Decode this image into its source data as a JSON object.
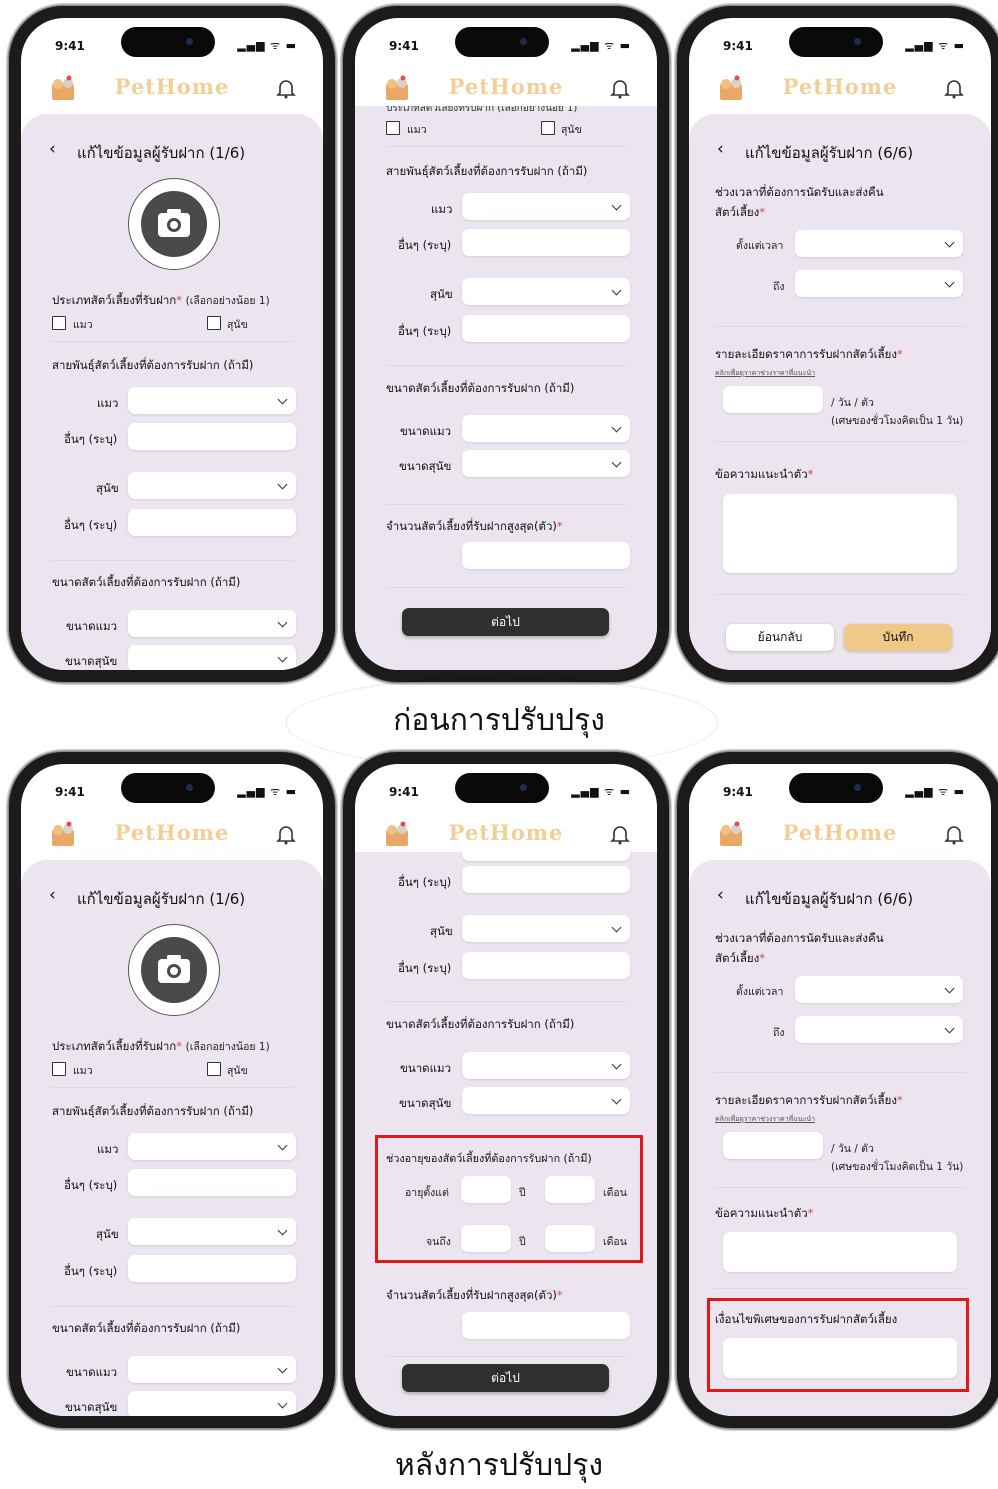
{
  "status": {
    "time": "9:41"
  },
  "app": {
    "brand": "PetHome"
  },
  "screen1": {
    "title": "แก้ไขข้อมูลผู้รับฝาก (1/6)",
    "pet_type_label": "ประเภทสัตว์เลี้ยงที่รับฝาก",
    "req": "*",
    "pet_type_hint": "(เลือกอย่างน้อย 1)",
    "cat": "แมว",
    "dog": "สุนัข",
    "breed_section": "สายพันธุ์สัตว์เลี้ยงที่ต้องการรับฝาก (ถ้ามี)",
    "other": "อื่นๆ (ระบุ)",
    "size_section": "ขนาดสัตว์เลี้ยงที่ต้องการรับฝาก (ถ้ามี)",
    "cat_size": "ขนาดแมว",
    "dog_size": "ขนาดสุนัข"
  },
  "screen2": {
    "cut_header": "ประเภทสัตว์เลี้ยงที่รับฝาก (เลือกอย่างน้อย 1)",
    "max_label": "จำนวนสัตว์เลี้ยงที่รับฝากสูงสุด(ตัว)",
    "next": "ต่อไป",
    "age_section": "ช่วงอายุของสัตว์เลี้ยงที่ต้องการรับฝาก (ถ้ามี)",
    "age_from": "อายุตั้งแต่",
    "age_to": "จนถึง",
    "year": "ปี",
    "month": "เดือน"
  },
  "screen3": {
    "title": "แก้ไขข้อมูลผู้รับฝาก (6/6)",
    "time_label_1": "ช่วงเวลาที่ต้องการนัดรับและส่งคืน",
    "time_label_2": "สัตว์เลี้ยง",
    "from": "ตั้งแต่เวลา",
    "to": "ถึง",
    "price_label": "รายละเอียดราคาการรับฝากสัตว์เลี้ยง",
    "price_link": "คลิกเพื่อดูราคาช่วงราคาที่แนะนำ",
    "per": "/ วัน / ตัว",
    "per_note": "(เศษของชั่วโมงคิดเป็น 1 วัน)",
    "intro_label": "ข้อความแนะนำตัว",
    "back": "ย้อนกลับ",
    "save": "บันทึก",
    "special_label": "เงื่อนไขพิเศษของการรับฝากสัตว์เลี้ยง"
  },
  "captions": {
    "before": "ก่อนการปรับปรุง",
    "after": "หลังการปรับปรุง"
  },
  "colors": {
    "accent": "#f0c887",
    "panel": "#ece4ee",
    "highlight": "#e01818",
    "dark_button": "#2f2f2f"
  },
  "icons": [
    "back-arrow-icon",
    "bell-icon",
    "camera-icon",
    "chevron-down-icon",
    "pets-logo-icon",
    "signal-icon",
    "wifi-icon",
    "battery-icon"
  ]
}
